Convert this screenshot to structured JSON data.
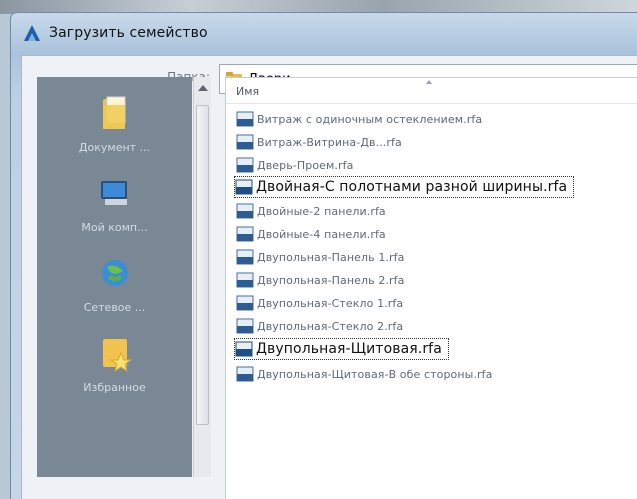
{
  "window": {
    "title": "Загрузить семейство"
  },
  "folder": {
    "label": "Папка:",
    "value": "Двери"
  },
  "places": [
    {
      "label": "Документ ...",
      "icon": "documents-folder-icon"
    },
    {
      "label": "Мой комп...",
      "icon": "my-computer-icon"
    },
    {
      "label": "Сетевое ...",
      "icon": "network-icon"
    },
    {
      "label": "Избранное",
      "icon": "favorites-folder-icon"
    }
  ],
  "filelist": {
    "column_name": "Имя",
    "files": [
      "Витраж с одиночным остеклением.rfa",
      "Витраж-Витрина-Дв...rfa",
      "Дверь-Проем.rfa",
      "Двойная-С полотнами разной ширины.rfa",
      "Двойные-2 панели.rfa",
      "Двойные-4 панели.rfa",
      "Двупольная-Панель 1.rfa",
      "Двупольная-Панель 2.rfa",
      "Двупольная-Стекло 1.rfa",
      "Двупольная-Стекло 2.rfa",
      "Двупольная-Щитовая.rfa",
      "Двупольная-Щитовая-В обе стороны.rfa"
    ],
    "icon_badge": "RFA"
  },
  "colors": {
    "accent": "#2a6fb5",
    "places_bg": "#7a8794"
  }
}
